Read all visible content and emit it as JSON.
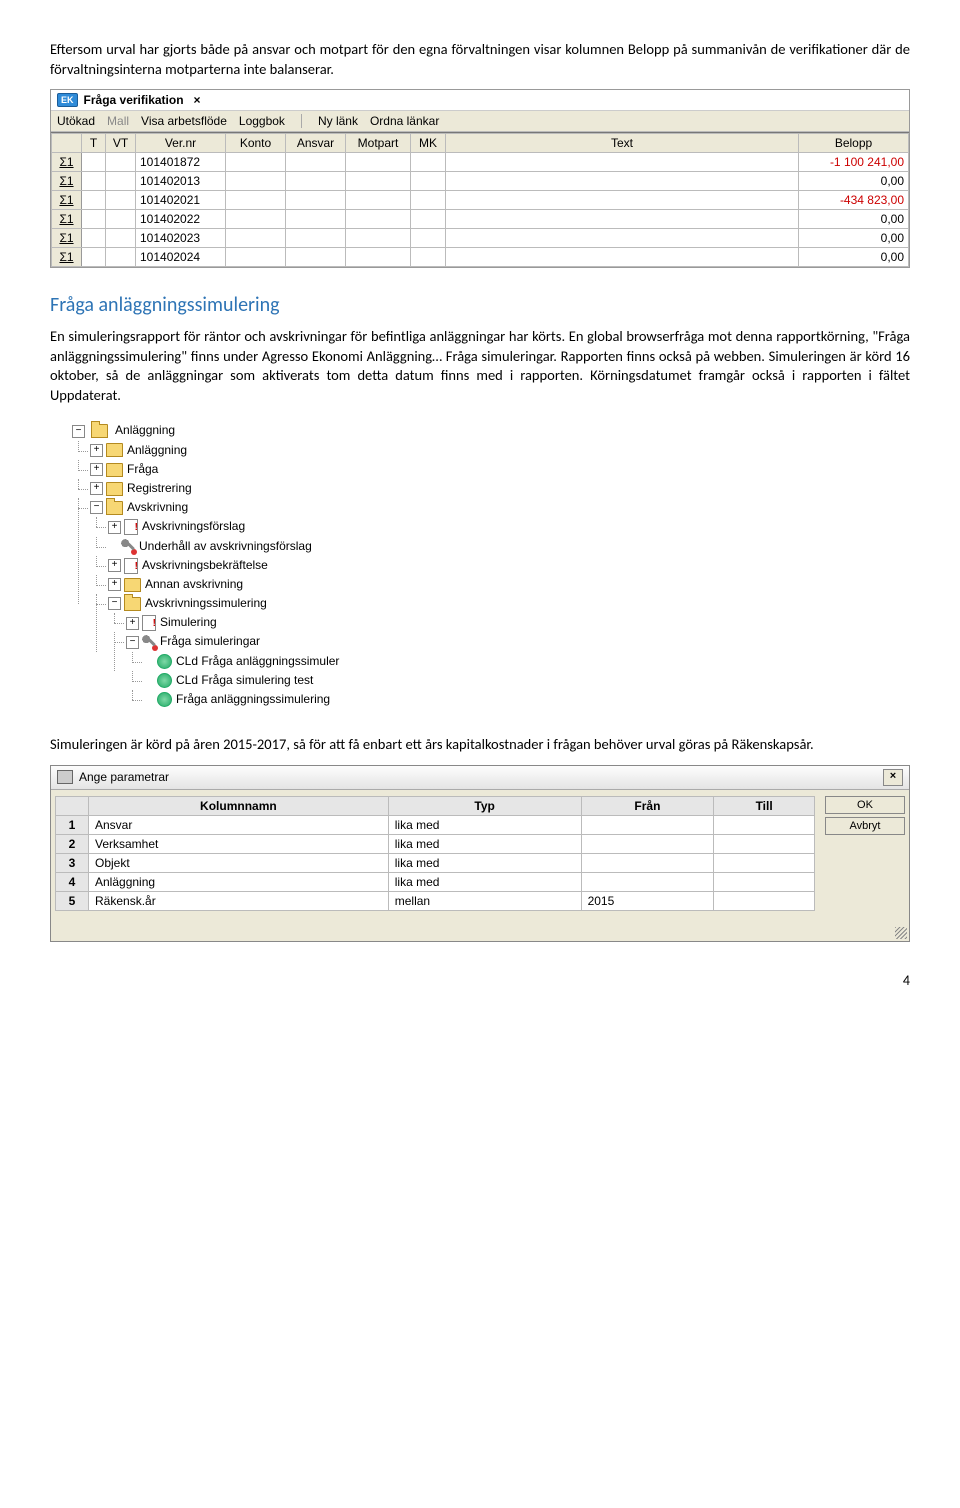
{
  "paragraphs": {
    "p1": "Eftersom urval har gjorts både på ansvar och motpart för den egna förvaltningen visar kolumnen Belopp på summanivån de verifikationer där de förvaltningsinterna motparterna inte balanserar."
  },
  "ver_window": {
    "title": "Fråga verifikation",
    "close": "×",
    "toolbar": {
      "utokad": "Utökad",
      "mall": "Mall",
      "visa_arb": "Visa arbetsflöde",
      "loggbok": "Loggbok",
      "ny_lank": "Ny länk",
      "ordna_lankar": "Ordna länkar"
    },
    "headers": [
      "",
      "T",
      "VT",
      "Ver.nr",
      "Konto",
      "Ansvar",
      "Motpart",
      "MK",
      "Text",
      "Belopp"
    ],
    "rows": [
      {
        "sigma": "Σ1",
        "vernr": "101401872",
        "belopp": "-1 100 241,00",
        "red": true
      },
      {
        "sigma": "Σ1",
        "vernr": "101402013",
        "belopp": "0,00",
        "red": false
      },
      {
        "sigma": "Σ1",
        "vernr": "101402021",
        "belopp": "-434 823,00",
        "red": true
      },
      {
        "sigma": "Σ1",
        "vernr": "101402022",
        "belopp": "0,00",
        "red": false
      },
      {
        "sigma": "Σ1",
        "vernr": "101402023",
        "belopp": "0,00",
        "red": false
      },
      {
        "sigma": "Σ1",
        "vernr": "101402024",
        "belopp": "0,00",
        "red": false
      }
    ]
  },
  "heading_sim": "Fråga anläggningssimulering",
  "paragraphs2": {
    "p2": "En simuleringsrapport för räntor och avskrivningar för befintliga anläggningar har körts. En global browserfråga mot denna rapportkörning, \"Fråga anläggningssimulering\" finns under Agresso Ekonomi Anläggning… Fråga simuleringar. Rapporten finns också på webben. Simuleringen är körd 16 oktober, så de anläggningar som aktiverats tom detta datum finns med i rapporten. Körningsdatumet framgår också i rapporten i fältet Uppdaterat."
  },
  "tree": {
    "n0": "Anläggning",
    "n1": "Anläggning",
    "n2": "Fråga",
    "n3": "Registrering",
    "n4": "Avskrivning",
    "n4_0": "Avskrivningsförslag",
    "n4_1": "Underhåll av avskrivningsförslag",
    "n4_2": "Avskrivningsbekräftelse",
    "n4_3": "Annan avskrivning",
    "n4_4": "Avskrivningssimulering",
    "n4_4_0": "Simulering",
    "n4_4_1": "Fråga simuleringar",
    "n4_4_1_0": "CLd Fråga anläggningssimuler",
    "n4_4_1_1": "CLd Fråga simulering test",
    "n4_4_1_2": "Fråga anläggningssimulering"
  },
  "paragraphs3": {
    "p3": "Simuleringen är körd på åren 2015-2017, så för att få enbart ett års kapitalkostnader i frågan behöver urval göras på Räkenskapsår."
  },
  "param_window": {
    "title": "Ange parametrar",
    "close": "×",
    "headers": [
      "",
      "Kolumnnamn",
      "Typ",
      "Från",
      "Till"
    ],
    "rows": [
      {
        "n": "1",
        "col": "Ansvar",
        "typ": "lika med",
        "fran": "",
        "till": ""
      },
      {
        "n": "2",
        "col": "Verksamhet",
        "typ": "lika med",
        "fran": "",
        "till": ""
      },
      {
        "n": "3",
        "col": "Objekt",
        "typ": "lika med",
        "fran": "",
        "till": ""
      },
      {
        "n": "4",
        "col": "Anläggning",
        "typ": "lika med",
        "fran": "",
        "till": ""
      },
      {
        "n": "5",
        "col": "Räkensk.år",
        "typ": "mellan",
        "fran": "2015",
        "till": ""
      }
    ],
    "buttons": {
      "ok": "OK",
      "avbryt": "Avbryt"
    }
  },
  "page_number": "4"
}
